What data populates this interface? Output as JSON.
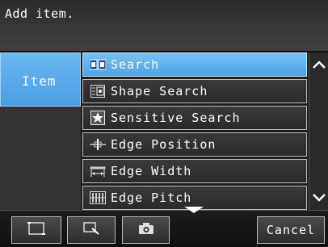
{
  "dialog": {
    "title": "Add item."
  },
  "category": {
    "label": "Item"
  },
  "items": [
    {
      "label": "Search",
      "icon": "search-icon",
      "selected": true
    },
    {
      "label": "Shape Search",
      "icon": "shape-search-icon",
      "selected": false
    },
    {
      "label": "Sensitive Search",
      "icon": "sensitive-search-icon",
      "selected": false
    },
    {
      "label": "Edge Position",
      "icon": "edge-position-icon",
      "selected": false
    },
    {
      "label": "Edge Width",
      "icon": "edge-width-icon",
      "selected": false
    },
    {
      "label": "Edge Pitch",
      "icon": "edge-pitch-icon",
      "selected": false
    }
  ],
  "toolbar": {
    "buttons": [
      {
        "icon": "frame-icon"
      },
      {
        "icon": "zoom-region-icon"
      },
      {
        "icon": "camera-icon"
      }
    ],
    "cancel_label": "Cancel"
  },
  "colors": {
    "selected": "#5aaeea",
    "background": "#2e2e2e",
    "border": "#bdbdbd"
  }
}
